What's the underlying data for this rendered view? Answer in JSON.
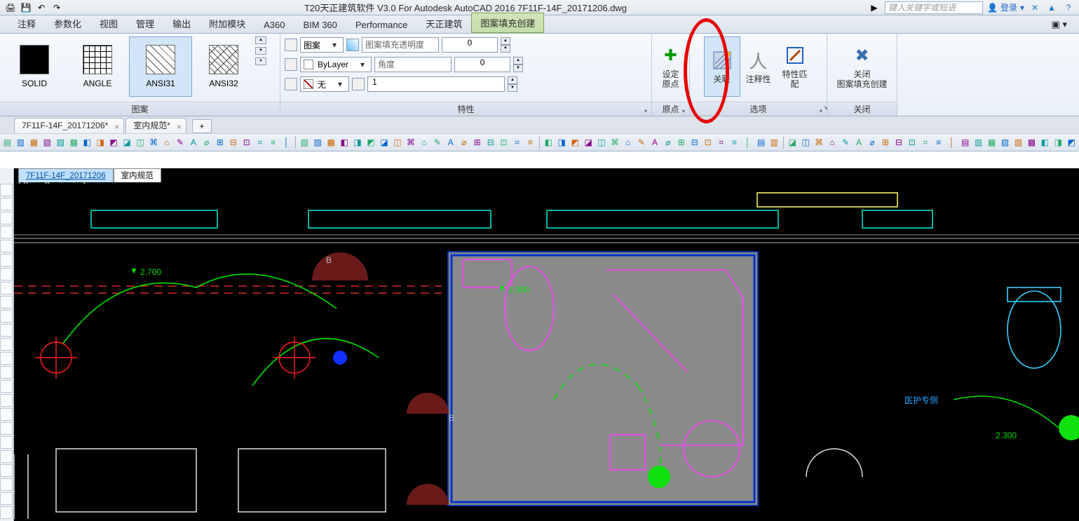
{
  "title": "T20天正建筑软件 V3.0 For Autodesk AutoCAD 2016    7F11F-14F_20171206.dwg",
  "search_placeholder": "键入关键字或短语",
  "login_label": "登录",
  "ribbon_tabs": {
    "items": [
      "注释",
      "参数化",
      "视图",
      "管理",
      "输出",
      "附加模块",
      "A360",
      "BIM 360",
      "Performance",
      "天正建筑",
      "图案填充创建"
    ],
    "overflow": "▣ ▾"
  },
  "panel_pattern": {
    "title": "图案",
    "items": [
      {
        "name": "SOLID",
        "swatchClass": "sw-solid"
      },
      {
        "name": "ANGLE",
        "swatchClass": "sw-angle"
      },
      {
        "name": "ANSI31",
        "swatchClass": "sw-diag"
      },
      {
        "name": "ANSI32",
        "swatchClass": "sw-diag2"
      }
    ],
    "selected": "ANSI31"
  },
  "panel_props": {
    "title": "特性",
    "row1": "图案",
    "row2": "ByLayer",
    "row3": "无",
    "transp_label": "图案填充透明度",
    "transp_val": "0",
    "angle_label": "角度",
    "angle_val": "0",
    "scale_val": "1"
  },
  "panels_right": {
    "origin": {
      "label": "设定\n原点",
      "title": "原点"
    },
    "assoc": {
      "label": "关联"
    },
    "annot": {
      "label": "注释性"
    },
    "options_title": "选项",
    "match": {
      "label": "特性匹配"
    },
    "close": {
      "label": "关闭\n图案填充创建",
      "title": "关闭"
    }
  },
  "file_tabs": {
    "t1": "7F11F-14F_20171206*",
    "t2": "室内规范*",
    "add": "+"
  },
  "inner_tabs": {
    "t1": "7F11F-14F_20171206",
    "t2": "室内规范"
  },
  "view_label": "[-][俯视][二维线框]",
  "drawing_text": {
    "dim1": "2.700",
    "dim2": "2.300",
    "dim3": "2.300",
    "b1": "B",
    "b2": "B",
    "label_right": "医护专侧"
  }
}
